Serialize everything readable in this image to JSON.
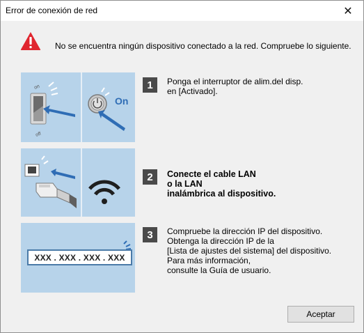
{
  "window": {
    "title": "Error de conexión de red",
    "close_glyph": "✕"
  },
  "message": "No se encuentra ningún dispositivo conectado a la red. Compruebe lo siguiente.",
  "icons": {
    "warning": "warning-triangle-icon",
    "power_switch": "power-switch-icon",
    "power_button": "power-button-icon",
    "lan_cable": "lan-cable-icon",
    "wifi": "wifi-icon",
    "signal": "signal-icon"
  },
  "steps": [
    {
      "number": "1",
      "lines": [
        "Ponga el interruptor de alim.del disp.",
        "en [Activado]."
      ],
      "illustration": {
        "switch_on": "on",
        "switch_off": "off",
        "button_on": "On"
      }
    },
    {
      "number": "2",
      "lines": [
        "Conecte el cable LAN",
        "o la LAN",
        "inalámbrica al dispositivo."
      ]
    },
    {
      "number": "3",
      "lines": [
        "Compruebe la dirección IP del dispositivo.",
        "Obtenga la dirección IP de la",
        "[Lista de ajustes del sistema] del dispositivo.",
        "Para más información,",
        "consulte la Guía de usuario."
      ],
      "ip_placeholder": "XXX . XXX . XXX . XXX"
    }
  ],
  "buttons": {
    "accept": "Aceptar"
  },
  "colors": {
    "panel": "#b7d3ea",
    "arrow": "#2f6db5",
    "warning_red": "#e0252e",
    "number_badge": "#4a4a4a"
  }
}
